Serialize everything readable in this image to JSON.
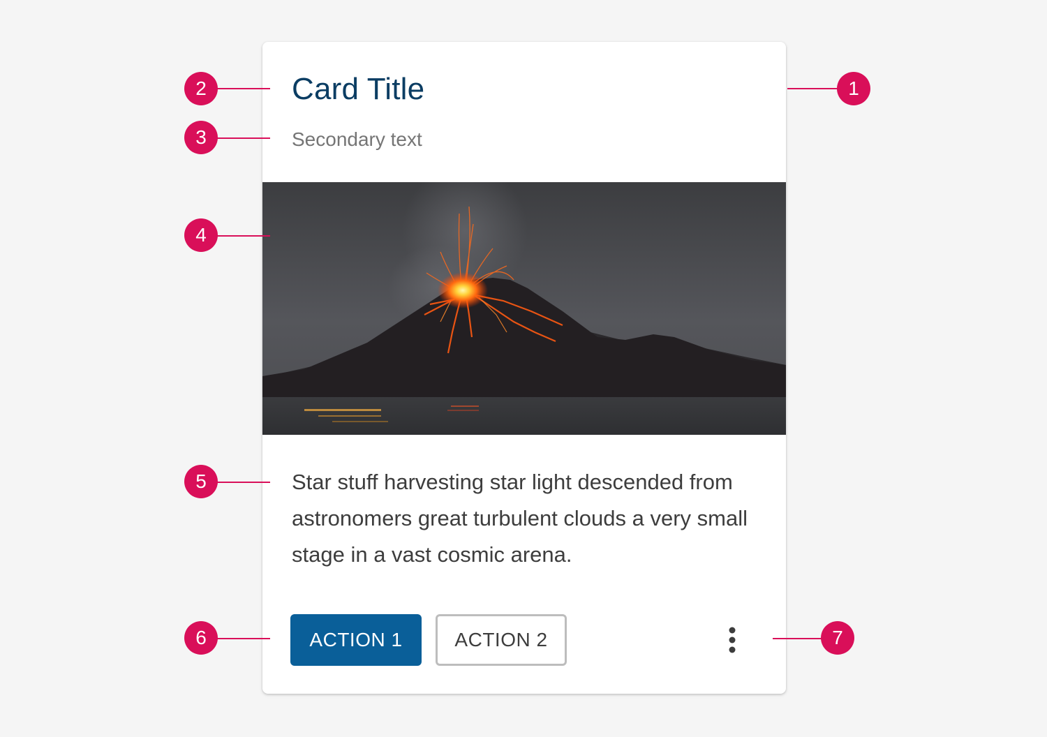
{
  "colors": {
    "background": "#f5f5f5",
    "card": "#ffffff",
    "title": "#0b3d63",
    "secondary_text": "#757575",
    "body_text": "#3d3d3d",
    "primary_button": "#0a5f99",
    "secondary_button_border": "#bdbdbd",
    "secondary_button_text": "#3d3d3d",
    "callout": "#d90f59",
    "overflow_icon": "#3d3d3d"
  },
  "card": {
    "title": "Card Title",
    "secondary_text": "Secondary text",
    "body": "Star stuff harvesting star light descended from astronomers great turbulent clouds a very small stage in a vast cosmic arena.",
    "actions": {
      "action1_label": "ACTION 1",
      "action2_label": "ACTION 2",
      "overflow_icon": "more-vertical-icon"
    }
  },
  "callouts": [
    "1",
    "2",
    "3",
    "4",
    "5",
    "6",
    "7"
  ]
}
